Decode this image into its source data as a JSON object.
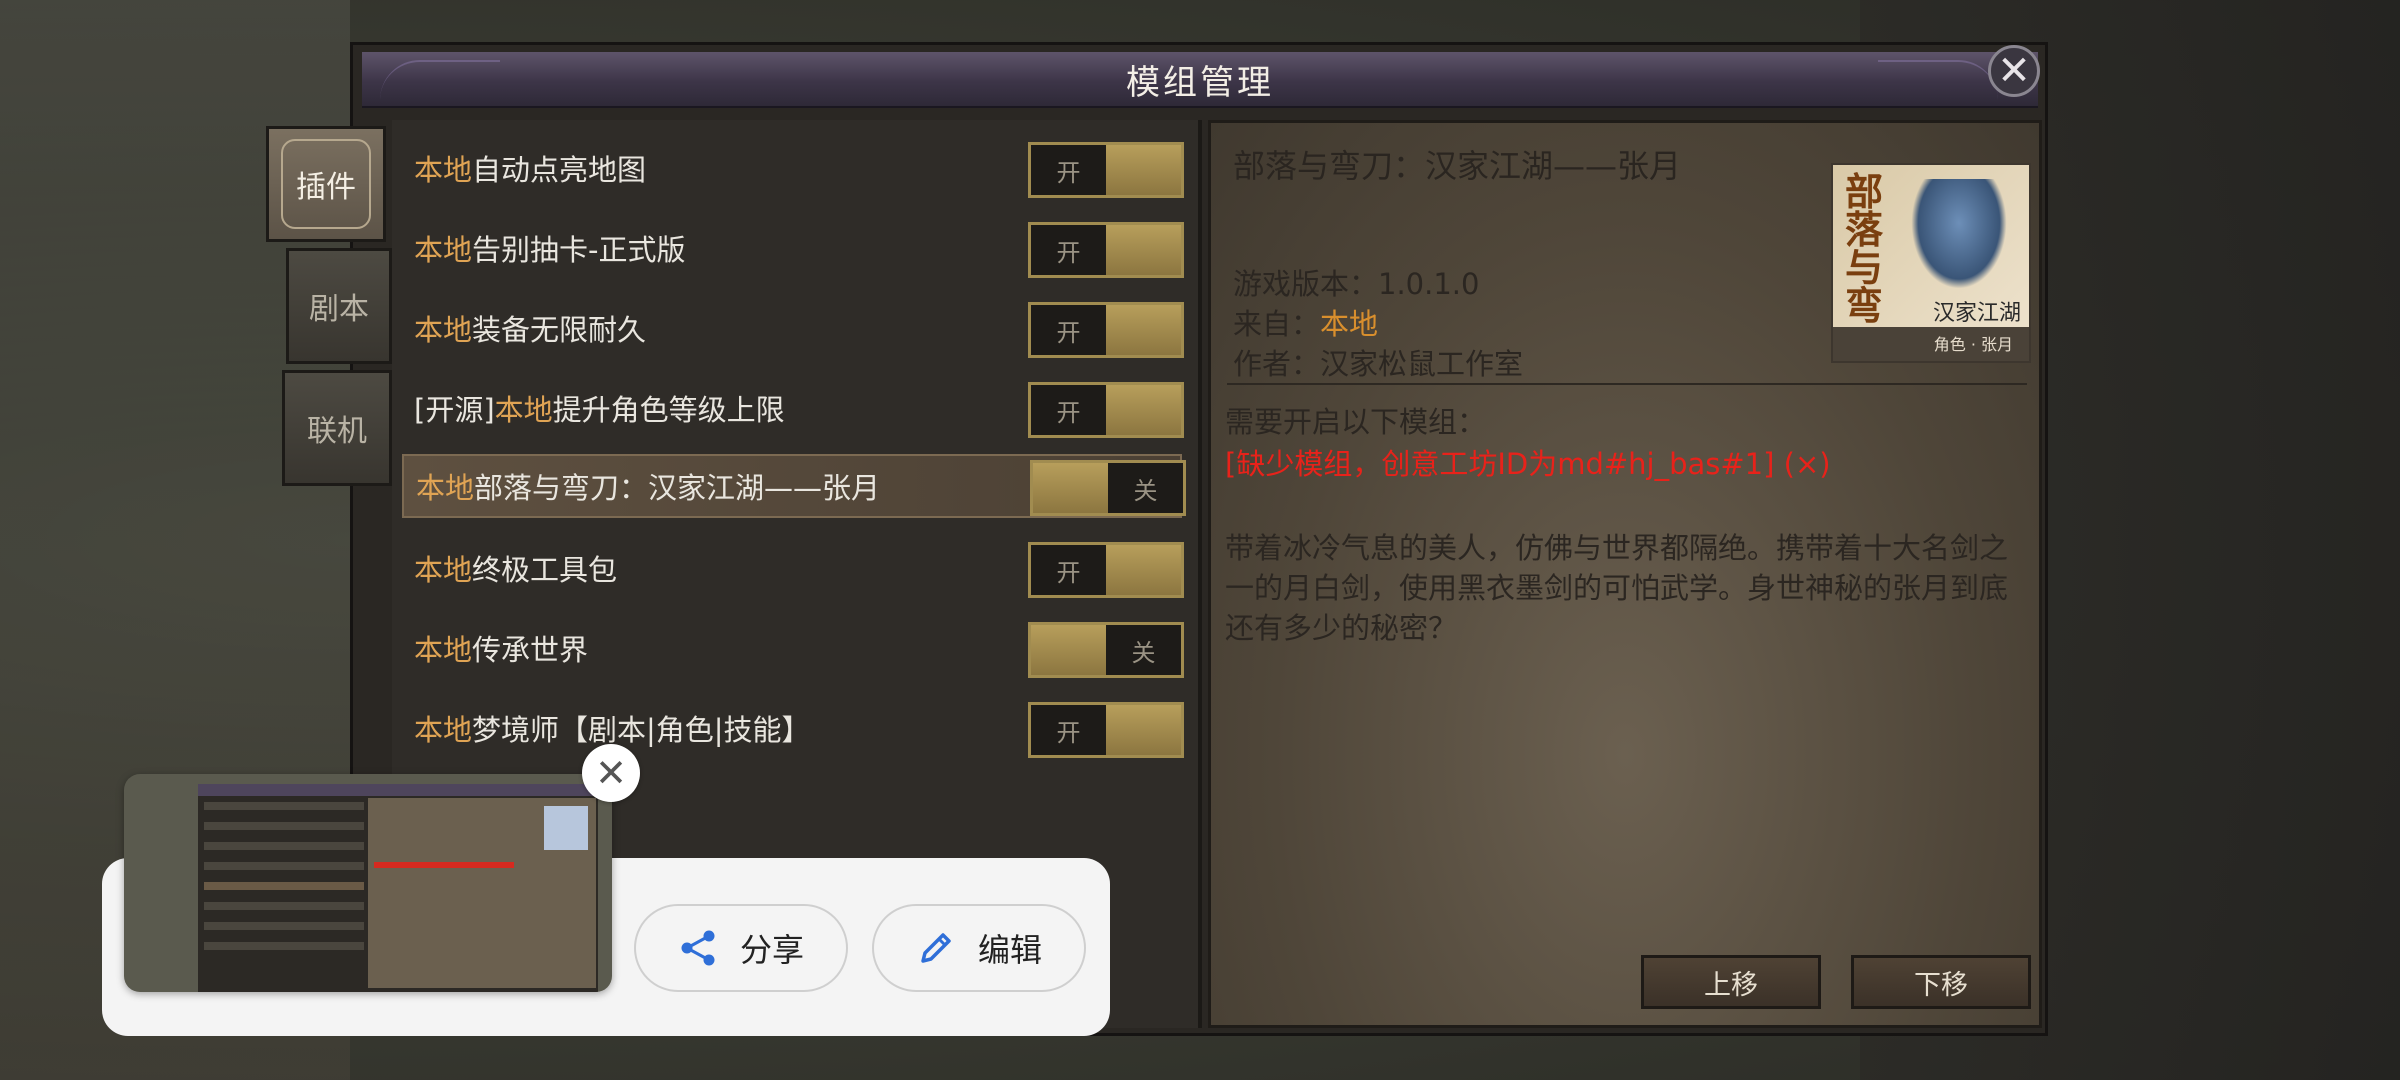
{
  "window": {
    "title": "模组管理",
    "close_glyph": "✕"
  },
  "tabs": [
    {
      "label": "插件",
      "active": true
    },
    {
      "label": "剧本",
      "active": false
    },
    {
      "label": "联机",
      "active": false
    }
  ],
  "mods": [
    {
      "source": "",
      "source_tag": "本地",
      "name": "自动点亮地图",
      "toggle_label": "开",
      "state": "on",
      "selected": false
    },
    {
      "source": "",
      "source_tag": "本地",
      "name": "告别抽卡-正式版",
      "toggle_label": "开",
      "state": "on",
      "selected": false
    },
    {
      "source": "",
      "source_tag": "本地",
      "name": "装备无限耐久",
      "toggle_label": "开",
      "state": "on",
      "selected": false
    },
    {
      "source": "[开源]",
      "source_tag": "本地",
      "name": "提升角色等级上限",
      "toggle_label": "开",
      "state": "on",
      "selected": false
    },
    {
      "source": "",
      "source_tag": "本地",
      "name": "部落与弯刀：汉家江湖——张月",
      "toggle_label": "关",
      "state": "off",
      "selected": true
    },
    {
      "source": "",
      "source_tag": "本地",
      "name": "终极工具包",
      "toggle_label": "开",
      "state": "on",
      "selected": false
    },
    {
      "source": "",
      "source_tag": "本地",
      "name": "传承世界",
      "toggle_label": "关",
      "state": "off",
      "selected": false
    },
    {
      "source": "",
      "source_tag": "本地",
      "name": "梦境师【剧本|角色|技能】",
      "toggle_label": "开",
      "state": "on",
      "selected": false
    }
  ],
  "detail": {
    "title": "部落与弯刀：汉家江湖——张月",
    "version_label": "游戏版本：",
    "version": "1.0.1.0",
    "from_label": "来自：",
    "from": "本地",
    "author_label": "作者：",
    "author": "汉家松鼠工作室",
    "requires_label": "需要开启以下模组：",
    "missing": "[缺少模组，创意工坊ID为md#hj_bas#1] (×)",
    "description": "带着冰冷气息的美人，仿佛与世界都隔绝。携带着十大名剑之一的月白剑，使用黑衣墨剑的可怕武学。身世神秘的张月到底还有多少的秘密？",
    "cover": {
      "title_text": "部落与弯刀",
      "subtitle_text": "汉家江湖",
      "band_text": "角色 · 张月"
    },
    "move_up": "上移",
    "move_down": "下移"
  },
  "share_sheet": {
    "close_glyph": "✕",
    "share_label": "分享",
    "edit_label": "编辑",
    "share_icon": "share-icon",
    "edit_icon": "pencil-icon"
  },
  "colors": {
    "source_tag": "#e0a454",
    "missing_mod": "#e8221a",
    "from_highlight": "#d98f2d",
    "toggle_knob": "#b79e5b",
    "icon_blue": "#2f6fd8"
  }
}
